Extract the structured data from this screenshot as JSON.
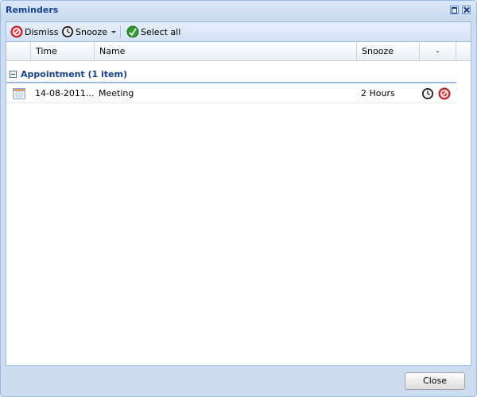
{
  "window": {
    "title": "Reminders"
  },
  "toolbar": {
    "dismiss_label": "Dismiss",
    "snooze_label": "Snooze",
    "select_all_label": "Select all"
  },
  "columns": {
    "time": "Time",
    "name": "Name",
    "snooze": "Snooze",
    "actions": "-"
  },
  "group": {
    "label": "Appointment (1 item)"
  },
  "rows": [
    {
      "time": "14-08-2011...",
      "name": "Meeting",
      "snooze": "2 Hours"
    }
  ],
  "footer": {
    "close_label": "Close"
  },
  "colors": {
    "accent": "#15428b",
    "border": "#99bbe8",
    "window_bg": "#cddcef"
  },
  "icons": {
    "dismiss": "dismiss-icon",
    "snooze": "clock-icon",
    "select_all": "select-all-icon",
    "calendar": "calendar-icon"
  }
}
